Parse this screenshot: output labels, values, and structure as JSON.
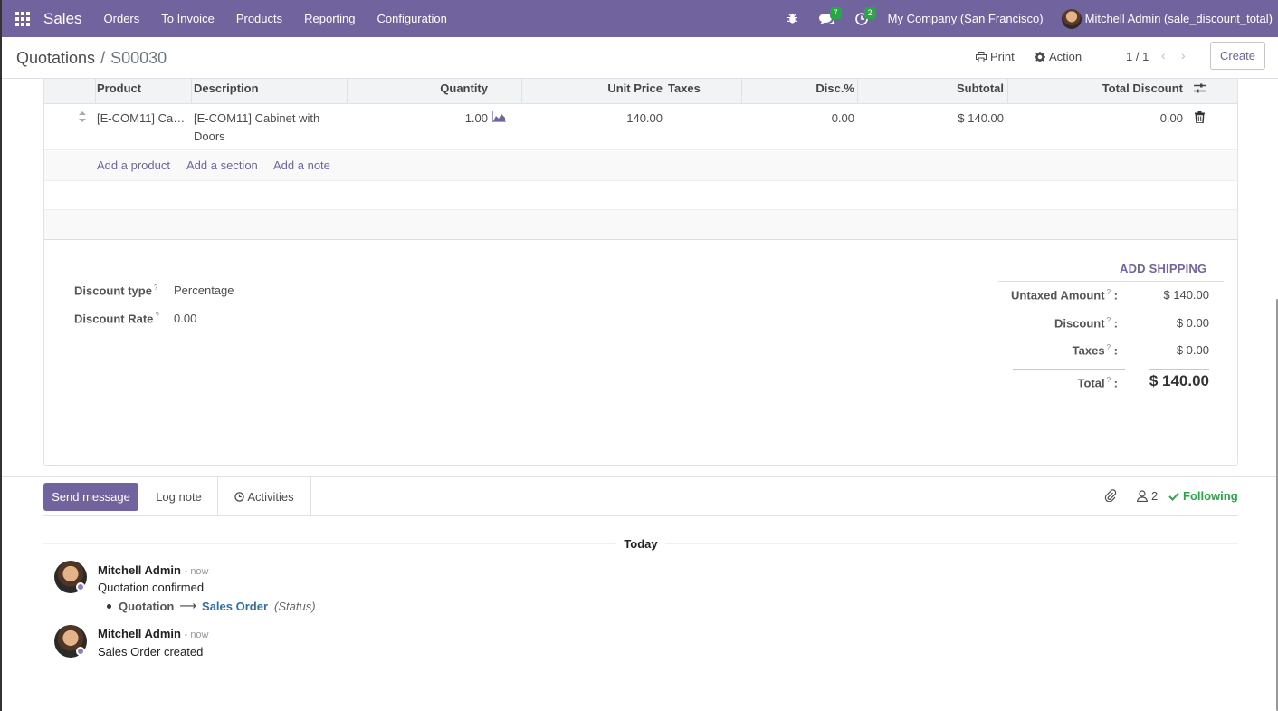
{
  "navbar": {
    "app_name": "Sales",
    "menu": [
      "Orders",
      "To Invoice",
      "Products",
      "Reporting",
      "Configuration"
    ],
    "messages_count": "7",
    "activities_count": "2",
    "company": "My Company (San Francisco)",
    "user": "Mitchell Admin (sale_discount_total)",
    "color": "#71639e"
  },
  "control": {
    "breadcrumb_parent": "Quotations",
    "breadcrumb_sep": "/",
    "breadcrumb_current": "S00030",
    "print_label": "Print",
    "action_label": "Action",
    "pager": "1 / 1",
    "create_label": "Create"
  },
  "lines": {
    "headers": {
      "product": "Product",
      "description": "Description",
      "quantity": "Quantity",
      "unit_price": "Unit Price",
      "taxes": "Taxes",
      "discount": "Disc.%",
      "subtotal": "Subtotal",
      "total_discount": "Total Discount"
    },
    "rows": [
      {
        "product": "[E-COM11] Ca…",
        "description_1": "[E-COM11] Cabinet with",
        "description_2": "Doors",
        "quantity": "1.00",
        "unit_price": "140.00",
        "taxes": "",
        "discount": "0.00",
        "subtotal": "$ 140.00",
        "total_discount": "0.00"
      }
    ],
    "add_product": "Add a product",
    "add_section": "Add a section",
    "add_note": "Add a note"
  },
  "discount": {
    "type_label": "Discount type",
    "type_value": "Percentage",
    "rate_label": "Discount Rate",
    "rate_value": "0.00",
    "help_mark": "?"
  },
  "totals": {
    "add_shipping": "ADD SHIPPING",
    "untaxed_label": "Untaxed Amount",
    "untaxed_value": "$ 140.00",
    "discount_label": "Discount",
    "discount_value": "$ 0.00",
    "taxes_label": "Taxes",
    "taxes_value": "$ 0.00",
    "total_label": "Total",
    "total_value": "$ 140.00",
    "colon": ":"
  },
  "chatter": {
    "send_message": "Send message",
    "log_note": "Log note",
    "activities": "Activities",
    "followers_count": "2",
    "following": "Following",
    "date_separator": "Today",
    "messages": [
      {
        "author": "Mitchell Admin",
        "time": "- now",
        "body": "Quotation confirmed",
        "track_old": "Quotation",
        "track_new": "Sales Order",
        "track_field": "(Status)"
      },
      {
        "author": "Mitchell Admin",
        "time": "- now",
        "body": "Sales Order created"
      }
    ]
  }
}
